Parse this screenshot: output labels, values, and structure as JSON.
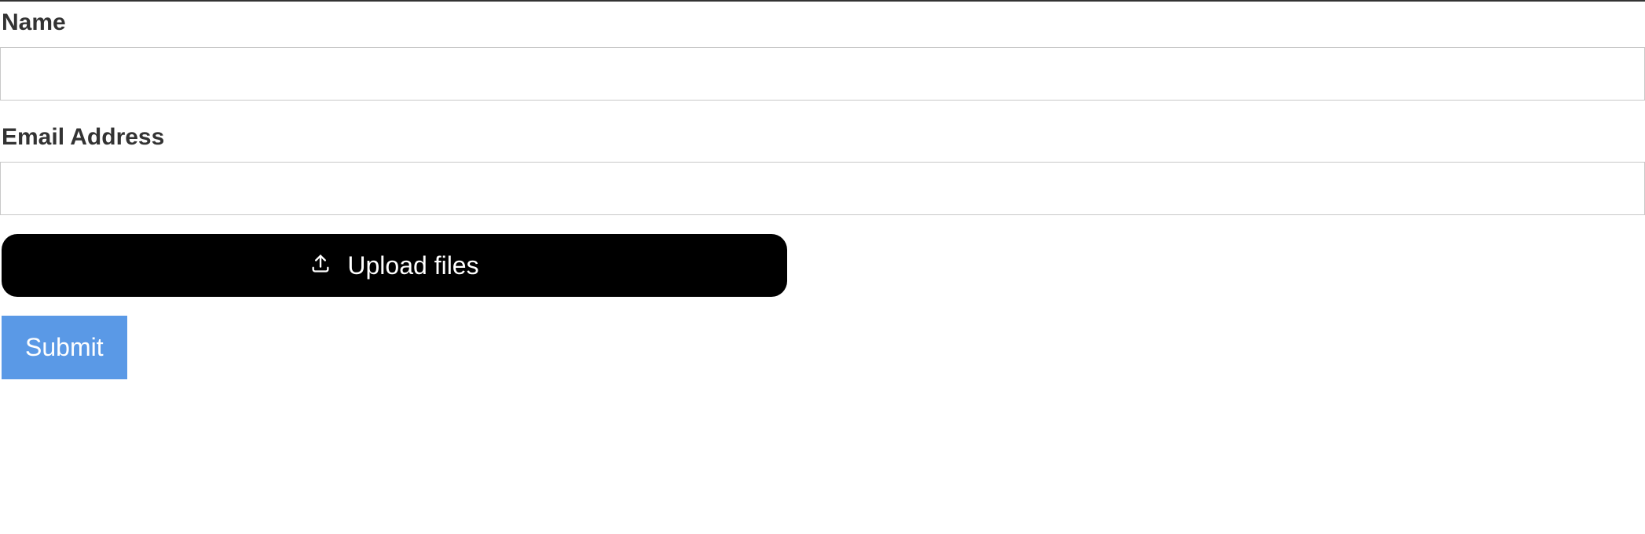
{
  "form": {
    "name": {
      "label": "Name",
      "value": ""
    },
    "email": {
      "label": "Email Address",
      "value": ""
    },
    "upload": {
      "label": "Upload files"
    },
    "submit": {
      "label": "Submit"
    }
  },
  "colors": {
    "label_text": "#333333",
    "input_border": "#c8c8c8",
    "upload_bg": "#000000",
    "upload_fg": "#ffffff",
    "submit_bg": "#5a99e6",
    "submit_fg": "#ffffff"
  }
}
